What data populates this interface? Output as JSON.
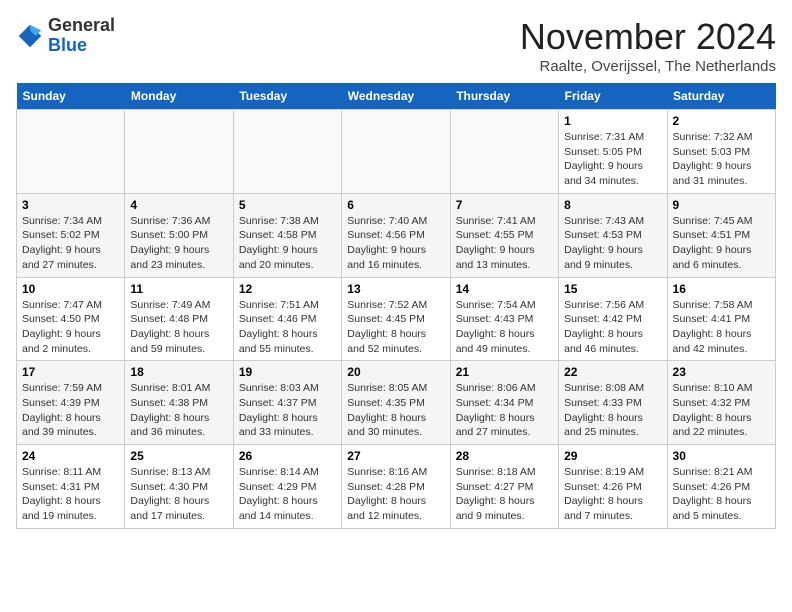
{
  "header": {
    "logo_general": "General",
    "logo_blue": "Blue",
    "month_title": "November 2024",
    "location": "Raalte, Overijssel, The Netherlands"
  },
  "weekdays": [
    "Sunday",
    "Monday",
    "Tuesday",
    "Wednesday",
    "Thursday",
    "Friday",
    "Saturday"
  ],
  "weeks": [
    [
      {
        "day": "",
        "info": ""
      },
      {
        "day": "",
        "info": ""
      },
      {
        "day": "",
        "info": ""
      },
      {
        "day": "",
        "info": ""
      },
      {
        "day": "",
        "info": ""
      },
      {
        "day": "1",
        "info": "Sunrise: 7:31 AM\nSunset: 5:05 PM\nDaylight: 9 hours and 34 minutes."
      },
      {
        "day": "2",
        "info": "Sunrise: 7:32 AM\nSunset: 5:03 PM\nDaylight: 9 hours and 31 minutes."
      }
    ],
    [
      {
        "day": "3",
        "info": "Sunrise: 7:34 AM\nSunset: 5:02 PM\nDaylight: 9 hours and 27 minutes."
      },
      {
        "day": "4",
        "info": "Sunrise: 7:36 AM\nSunset: 5:00 PM\nDaylight: 9 hours and 23 minutes."
      },
      {
        "day": "5",
        "info": "Sunrise: 7:38 AM\nSunset: 4:58 PM\nDaylight: 9 hours and 20 minutes."
      },
      {
        "day": "6",
        "info": "Sunrise: 7:40 AM\nSunset: 4:56 PM\nDaylight: 9 hours and 16 minutes."
      },
      {
        "day": "7",
        "info": "Sunrise: 7:41 AM\nSunset: 4:55 PM\nDaylight: 9 hours and 13 minutes."
      },
      {
        "day": "8",
        "info": "Sunrise: 7:43 AM\nSunset: 4:53 PM\nDaylight: 9 hours and 9 minutes."
      },
      {
        "day": "9",
        "info": "Sunrise: 7:45 AM\nSunset: 4:51 PM\nDaylight: 9 hours and 6 minutes."
      }
    ],
    [
      {
        "day": "10",
        "info": "Sunrise: 7:47 AM\nSunset: 4:50 PM\nDaylight: 9 hours and 2 minutes."
      },
      {
        "day": "11",
        "info": "Sunrise: 7:49 AM\nSunset: 4:48 PM\nDaylight: 8 hours and 59 minutes."
      },
      {
        "day": "12",
        "info": "Sunrise: 7:51 AM\nSunset: 4:46 PM\nDaylight: 8 hours and 55 minutes."
      },
      {
        "day": "13",
        "info": "Sunrise: 7:52 AM\nSunset: 4:45 PM\nDaylight: 8 hours and 52 minutes."
      },
      {
        "day": "14",
        "info": "Sunrise: 7:54 AM\nSunset: 4:43 PM\nDaylight: 8 hours and 49 minutes."
      },
      {
        "day": "15",
        "info": "Sunrise: 7:56 AM\nSunset: 4:42 PM\nDaylight: 8 hours and 46 minutes."
      },
      {
        "day": "16",
        "info": "Sunrise: 7:58 AM\nSunset: 4:41 PM\nDaylight: 8 hours and 42 minutes."
      }
    ],
    [
      {
        "day": "17",
        "info": "Sunrise: 7:59 AM\nSunset: 4:39 PM\nDaylight: 8 hours and 39 minutes."
      },
      {
        "day": "18",
        "info": "Sunrise: 8:01 AM\nSunset: 4:38 PM\nDaylight: 8 hours and 36 minutes."
      },
      {
        "day": "19",
        "info": "Sunrise: 8:03 AM\nSunset: 4:37 PM\nDaylight: 8 hours and 33 minutes."
      },
      {
        "day": "20",
        "info": "Sunrise: 8:05 AM\nSunset: 4:35 PM\nDaylight: 8 hours and 30 minutes."
      },
      {
        "day": "21",
        "info": "Sunrise: 8:06 AM\nSunset: 4:34 PM\nDaylight: 8 hours and 27 minutes."
      },
      {
        "day": "22",
        "info": "Sunrise: 8:08 AM\nSunset: 4:33 PM\nDaylight: 8 hours and 25 minutes."
      },
      {
        "day": "23",
        "info": "Sunrise: 8:10 AM\nSunset: 4:32 PM\nDaylight: 8 hours and 22 minutes."
      }
    ],
    [
      {
        "day": "24",
        "info": "Sunrise: 8:11 AM\nSunset: 4:31 PM\nDaylight: 8 hours and 19 minutes."
      },
      {
        "day": "25",
        "info": "Sunrise: 8:13 AM\nSunset: 4:30 PM\nDaylight: 8 hours and 17 minutes."
      },
      {
        "day": "26",
        "info": "Sunrise: 8:14 AM\nSunset: 4:29 PM\nDaylight: 8 hours and 14 minutes."
      },
      {
        "day": "27",
        "info": "Sunrise: 8:16 AM\nSunset: 4:28 PM\nDaylight: 8 hours and 12 minutes."
      },
      {
        "day": "28",
        "info": "Sunrise: 8:18 AM\nSunset: 4:27 PM\nDaylight: 8 hours and 9 minutes."
      },
      {
        "day": "29",
        "info": "Sunrise: 8:19 AM\nSunset: 4:26 PM\nDaylight: 8 hours and 7 minutes."
      },
      {
        "day": "30",
        "info": "Sunrise: 8:21 AM\nSunset: 4:26 PM\nDaylight: 8 hours and 5 minutes."
      }
    ]
  ]
}
